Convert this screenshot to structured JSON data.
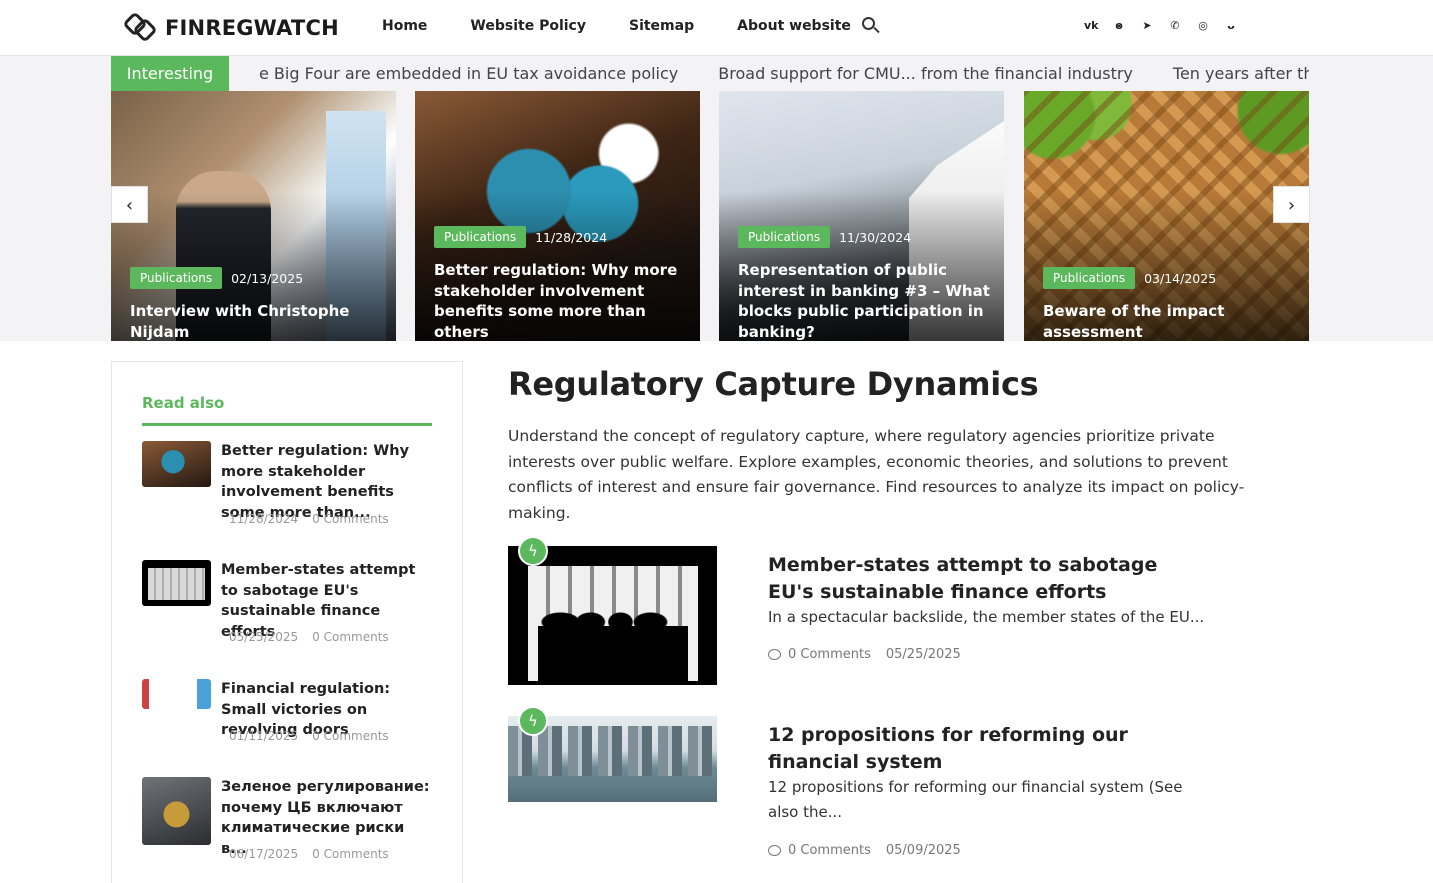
{
  "header": {
    "logo_text": "FINREGWATCH",
    "nav": [
      "Home",
      "Website Policy",
      "Sitemap",
      "About website"
    ],
    "social": [
      "vk-icon",
      "ok-icon",
      "telegram-icon",
      "viber-icon",
      "whatsapp-icon",
      "moimir-icon"
    ]
  },
  "ticker": {
    "label": "Interesting",
    "items": [
      "e Big Four are embedded in EU tax avoidance policy",
      "Broad support for CMU... from the financial industry",
      "Ten years after the crash, is civil"
    ]
  },
  "slider": {
    "prev": "‹",
    "next": "›",
    "slides": [
      {
        "category": "Publications",
        "date": "02/13/2025",
        "title": "Interview with Christophe Nijdam"
      },
      {
        "category": "Publications",
        "date": "11/28/2024",
        "title": "Better regulation: Why more stakeholder involvement benefits some more than others"
      },
      {
        "category": "Publications",
        "date": "11/30/2024",
        "title": "Representation of public interest in banking #3 – What blocks public participation in banking?"
      },
      {
        "category": "Publications",
        "date": "03/14/2025",
        "title": "Beware of the impact assessment"
      }
    ]
  },
  "sidebar": {
    "title": "Read also",
    "items": [
      {
        "title": "Better regulation: Why more stakeholder involvement benefits some more than...",
        "date": "11/28/2024",
        "comments": "0 Comments"
      },
      {
        "title": "Member-states attempt to sabotage EU's sustainable finance efforts",
        "date": "05/25/2025",
        "comments": "0 Comments"
      },
      {
        "title": "Financial regulation: Small victories on revolving doors",
        "date": "01/11/2025",
        "comments": "0 Comments"
      },
      {
        "title": "Зеленое регулирование: почему ЦБ включают климатические риски в...",
        "date": "06/17/2025",
        "comments": "0 Comments"
      }
    ]
  },
  "main": {
    "title": "Regulatory Capture Dynamics",
    "intro": "Understand the concept of regulatory capture, where regulatory agencies prioritize private interests over public welfare. Explore examples, economic theories, and solutions to prevent conflicts of interest and ensure fair governance. Find resources to analyze its impact on policy-making.",
    "posts": [
      {
        "title": "Member-states attempt to sabotage EU's sustainable finance efforts",
        "excerpt": "In a spectacular backslide, the member states of the EU...",
        "comments": "0 Comments",
        "date": "05/25/2025"
      },
      {
        "title": "12 propositions for reforming our financial system",
        "excerpt": "12 propositions for reforming our financial system (See also the...",
        "comments": "0 Comments",
        "date": "05/09/2025"
      }
    ]
  },
  "colors": {
    "accent": "#5cb85c"
  }
}
